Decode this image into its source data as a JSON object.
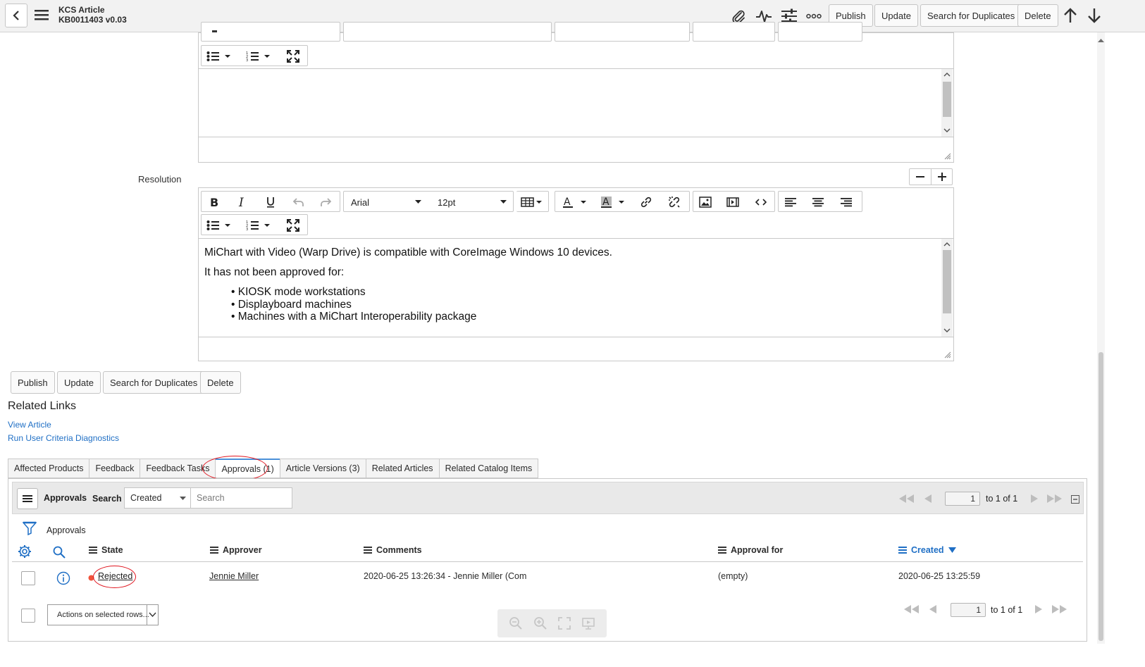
{
  "header": {
    "title": "KCS Article",
    "subtitle": "KB0011403 v0.03",
    "buttons": {
      "publish": "Publish",
      "update": "Update",
      "search_duplicates": "Search for Duplicates",
      "delete": "Delete"
    }
  },
  "resolution": {
    "label": "Resolution",
    "font": "Arial",
    "size": "12pt",
    "content": {
      "line1": "MiChart with Video (Warp Drive) is compatible with CoreImage Windows 10 devices.",
      "line2": "It has not been approved for:",
      "bullets": [
        "KIOSK mode workstations",
        "Displayboard machines",
        "Machines with a MiChart Interoperability package"
      ]
    }
  },
  "form_buttons": {
    "publish": "Publish",
    "update": "Update",
    "search_duplicates": "Search for Duplicates",
    "delete": "Delete"
  },
  "related_links": {
    "title": "Related Links",
    "links": [
      "View Article",
      "Run User Criteria Diagnostics"
    ]
  },
  "tabs": [
    "Affected Products",
    "Feedback",
    "Feedback Tasks",
    "Approvals (1)",
    "Article Versions (3)",
    "Related Articles",
    "Related Catalog Items"
  ],
  "approvals_list": {
    "title": "Approvals",
    "search_label": "Search",
    "search_field": "Created",
    "search_placeholder": "Search",
    "page_value": "1",
    "page_range": "to 1 of 1",
    "breadcrumb": "Approvals",
    "columns": [
      "State",
      "Approver",
      "Comments",
      "Approval for",
      "Created"
    ],
    "rows": [
      {
        "state": "Rejected",
        "approver": "Jennie Miller",
        "comments": "2020-06-25 13:26:34 - Jennie Miller (Com",
        "approval_for": "(empty)",
        "created": "2020-06-25 13:25:59"
      }
    ],
    "actions_placeholder": "Actions on selected rows...",
    "footer_page_value": "1",
    "footer_page_range": "to 1 of 1"
  },
  "colors": {
    "link": "#1f6fc5",
    "state_rejected": "#f0533b",
    "highlight_circle": "#e0141e"
  }
}
